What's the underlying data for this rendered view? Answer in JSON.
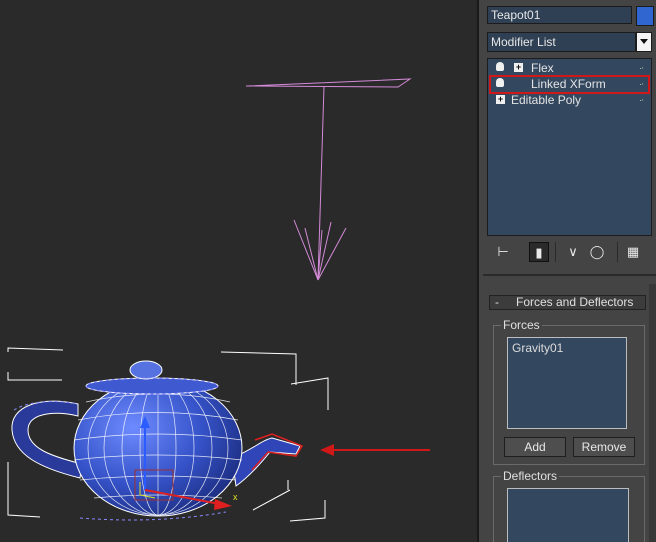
{
  "object_name": {
    "value": "Teapot01",
    "swatch_color": "#2f66d0"
  },
  "modifier_list": {
    "selected": "Modifier List"
  },
  "stack": {
    "items": [
      {
        "label": "Flex",
        "has_bulb": true,
        "expandable": true
      },
      {
        "label": "Linked XForm",
        "has_bulb": true,
        "expandable": false,
        "highlighted": true
      },
      {
        "label": "Editable Poly",
        "has_bulb": false,
        "expandable": true
      }
    ]
  },
  "stack_toolbar": {
    "icons": [
      "pin-stack-icon",
      "show-end-result-icon",
      "make-unique-icon",
      "remove-modifier-icon",
      "configure-modifier-sets-icon"
    ]
  },
  "forces_deflectors": {
    "title": "Forces and Deflectors",
    "collapse_symbol": "-",
    "forces": {
      "label": "Forces",
      "items": [
        "Gravity01"
      ],
      "add_label": "Add",
      "remove_label": "Remove"
    },
    "deflectors": {
      "label": "Deflectors",
      "items": []
    }
  },
  "colors": {
    "highlight": "#d01818",
    "arrow": "#d01818",
    "gravity_gizmo": "#d48ad8",
    "teapot_wire": "#6c6cff"
  }
}
